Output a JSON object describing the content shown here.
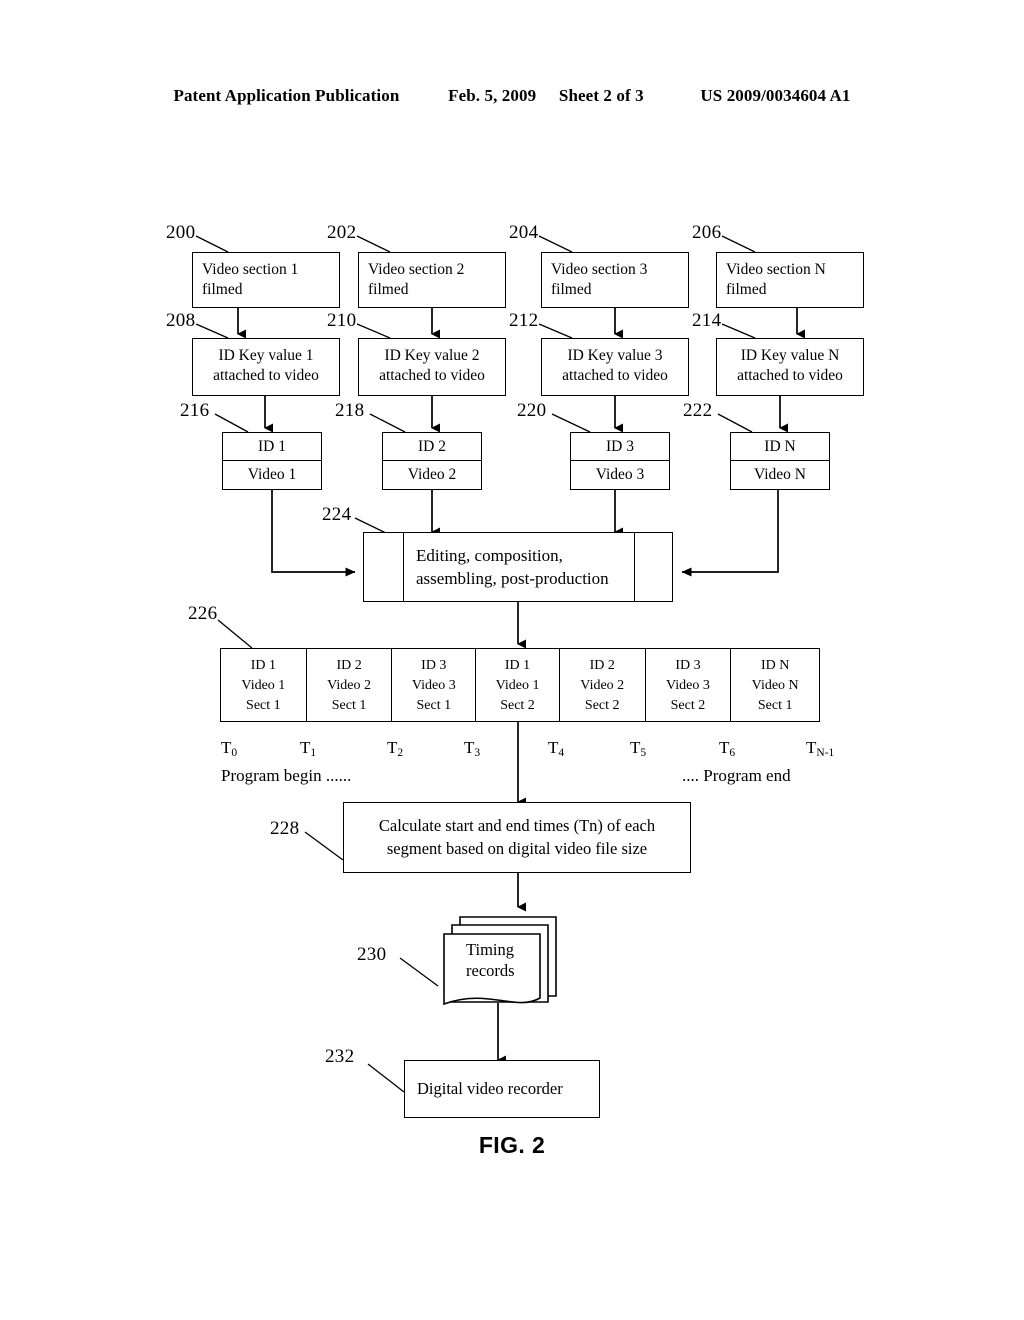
{
  "header": {
    "publication": "Patent Application Publication",
    "date": "Feb. 5, 2009",
    "sheet": "Sheet 2 of 3",
    "patent_number": "US 2009/0034604 A1"
  },
  "figure": {
    "caption": "FIG. 2"
  },
  "refs": {
    "r200": "200",
    "r202": "202",
    "r204": "204",
    "r206": "206",
    "r208": "208",
    "r210": "210",
    "r212": "212",
    "r214": "214",
    "r216": "216",
    "r218": "218",
    "r220": "220",
    "r222": "222",
    "r224": "224",
    "r226": "226",
    "r228": "228",
    "r230": "230",
    "r232": "232"
  },
  "video_sections": [
    {
      "line1": "Video section 1",
      "line2": "filmed"
    },
    {
      "line1": "Video section 2",
      "line2": "filmed"
    },
    {
      "line1": "Video section 3",
      "line2": "filmed"
    },
    {
      "line1": "Video section N",
      "line2": "filmed"
    }
  ],
  "id_key_values": [
    {
      "line1": "ID Key value 1",
      "line2": "attached to video"
    },
    {
      "line1": "ID Key value 2",
      "line2": "attached to video"
    },
    {
      "line1": "ID Key value 3",
      "line2": "attached to video"
    },
    {
      "line1": "ID Key value N",
      "line2": "attached to video"
    }
  ],
  "id_video_boxes": [
    {
      "id": "ID 1",
      "video": "Video 1"
    },
    {
      "id": "ID 2",
      "video": "Video 2"
    },
    {
      "id": "ID 3",
      "video": "Video 3"
    },
    {
      "id": "ID N",
      "video": "Video N"
    }
  ],
  "editing": {
    "line1": "Editing, composition,",
    "line2": "assembling, post-production"
  },
  "timeline_cells": [
    {
      "id": "ID 1",
      "video": "Video 1",
      "sect": "Sect 1"
    },
    {
      "id": "ID 2",
      "video": "Video 2",
      "sect": "Sect 1"
    },
    {
      "id": "ID 3",
      "video": "Video 3",
      "sect": "Sect 1"
    },
    {
      "id": "ID 1",
      "video": "Video 1",
      "sect": "Sect 2"
    },
    {
      "id": "ID 2",
      "video": "Video 2",
      "sect": "Sect 2"
    },
    {
      "id": "ID 3",
      "video": "Video 3",
      "sect": "Sect 2"
    },
    {
      "id": "ID N",
      "video": "Video N",
      "sect": "Sect 1"
    }
  ],
  "time_labels": [
    {
      "base": "T",
      "sub": "0"
    },
    {
      "base": "T",
      "sub": "1"
    },
    {
      "base": "T",
      "sub": "2"
    },
    {
      "base": "T",
      "sub": "3"
    },
    {
      "base": "T",
      "sub": "4"
    },
    {
      "base": "T",
      "sub": "5"
    },
    {
      "base": "T",
      "sub": "6"
    },
    {
      "base": "T",
      "sub": "N-1"
    }
  ],
  "program_markers": {
    "begin": "Program begin ......",
    "end": ".... Program end"
  },
  "calculate_box": {
    "line1": "Calculate start and end times (Tn) of each",
    "line2": "segment based on digital video file size"
  },
  "timing_records": {
    "line1": "Timing",
    "line2": "records"
  },
  "recorder_box": {
    "label": "Digital video recorder"
  },
  "colors": {
    "ink": "#000000",
    "page": "#ffffff"
  }
}
